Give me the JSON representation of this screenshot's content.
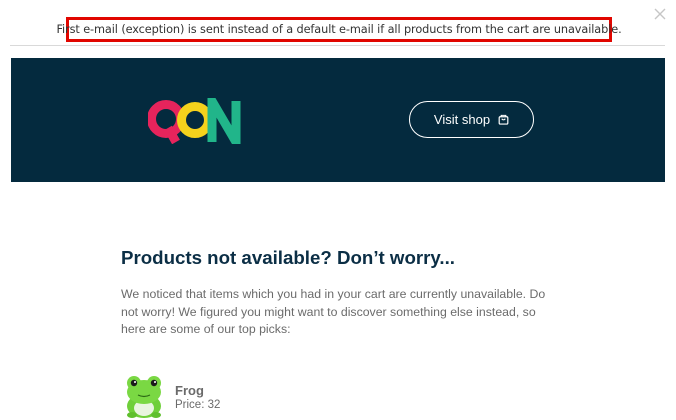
{
  "notice": {
    "text": "First e-mail (exception) is sent instead of a default e-mail if all products from the cart are unavailable."
  },
  "header": {
    "brand_name": "QON",
    "brand_colors": [
      "#e6245c",
      "#f5d21c",
      "#21b58a"
    ],
    "background_color": "#042a3e",
    "visit_label": "Visit shop",
    "visit_icon": "shopping-bag-icon"
  },
  "content": {
    "title": "Products not available? Don’t worry...",
    "body": "We noticed that items which you had in your cart are currently unavailable. Do not worry! We figured you might want to discover something else instead, so here are some of our top picks:"
  },
  "products": [
    {
      "name": "Frog",
      "price": "Price: 32",
      "image_icon": "frog-plush-icon"
    }
  ],
  "close_icon": "close-icon"
}
